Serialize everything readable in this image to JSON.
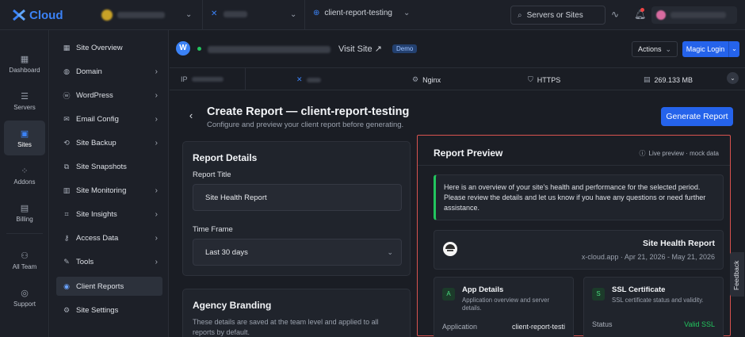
{
  "topbar": {
    "brand": "Cloud",
    "site_name": "client-report-testing",
    "search_placeholder": "Servers or Sites"
  },
  "rail": [
    {
      "label": "Dashboard",
      "icon": "grid-icon"
    },
    {
      "label": "Servers",
      "icon": "server-icon"
    },
    {
      "label": "Sites",
      "icon": "sites-icon",
      "active": true
    },
    {
      "label": "Addons",
      "icon": "addons-icon"
    },
    {
      "label": "Billing",
      "icon": "billing-icon"
    },
    {
      "label": "All Team",
      "icon": "team-icon"
    },
    {
      "label": "Support",
      "icon": "support-icon"
    }
  ],
  "subnav": [
    {
      "label": "Site Overview",
      "icon": "overview-icon"
    },
    {
      "label": "Domain",
      "icon": "globe-icon",
      "arrow": true
    },
    {
      "label": "WordPress",
      "icon": "wordpress-icon",
      "arrow": true
    },
    {
      "label": "Email Config",
      "icon": "mail-icon",
      "arrow": true
    },
    {
      "label": "Site Backup",
      "icon": "backup-icon",
      "arrow": true
    },
    {
      "label": "Site Snapshots",
      "icon": "snapshot-icon"
    },
    {
      "label": "Site Monitoring",
      "icon": "monitoring-icon",
      "arrow": true
    },
    {
      "label": "Site Insights",
      "icon": "insights-icon",
      "arrow": true
    },
    {
      "label": "Access Data",
      "icon": "key-icon",
      "arrow": true
    },
    {
      "label": "Tools",
      "icon": "tools-icon",
      "arrow": true
    },
    {
      "label": "Client Reports",
      "icon": "reports-icon",
      "active": true
    },
    {
      "label": "Site Settings",
      "icon": "settings-icon"
    }
  ],
  "site_header": {
    "visit_label": "Visit Site ↗",
    "demo_badge": "Demo",
    "actions_label": "Actions",
    "magic_login_label": "Magic Login"
  },
  "infobar": {
    "ip_label": "IP",
    "web_server": "Nginx",
    "protocol": "HTTPS",
    "storage": "269.133 MB"
  },
  "page": {
    "title": "Create Report — client-report-testing",
    "subtitle": "Configure and preview your client report before generating.",
    "generate_label": "Generate Report"
  },
  "report_details": {
    "heading": "Report Details",
    "title_label": "Report Title",
    "title_value": "Site Health Report",
    "timeframe_label": "Time Frame",
    "timeframe_value": "Last 30 days"
  },
  "agency_branding": {
    "heading": "Agency Branding",
    "note": "These details are saved at the team level and applied to all reports by default."
  },
  "preview": {
    "title": "Report Preview",
    "badge": "Live preview · mock data",
    "intro": "Here is an overview of your site's health and performance for the selected period. Please review the details and let us know if you have any questions or need further assistance.",
    "report_title": "Site Health Report",
    "report_meta": "x-cloud.app · Apr 21, 2026 - May 21, 2026",
    "app_card": {
      "icon_letter": "A",
      "title": "App Details",
      "subtitle": "Application overview and server details.",
      "key": "Application",
      "value": "client-report-testi"
    },
    "ssl_card": {
      "icon_letter": "S",
      "title": "SSL Certificate",
      "subtitle": "SSL certificate status and validity.",
      "key": "Status",
      "value": "Valid SSL"
    }
  },
  "feedback_label": "Feedback",
  "colors": {
    "accent": "#2563eb",
    "success": "#22c55e",
    "highlight_border": "#d9534f",
    "background": "#1a1d24"
  }
}
